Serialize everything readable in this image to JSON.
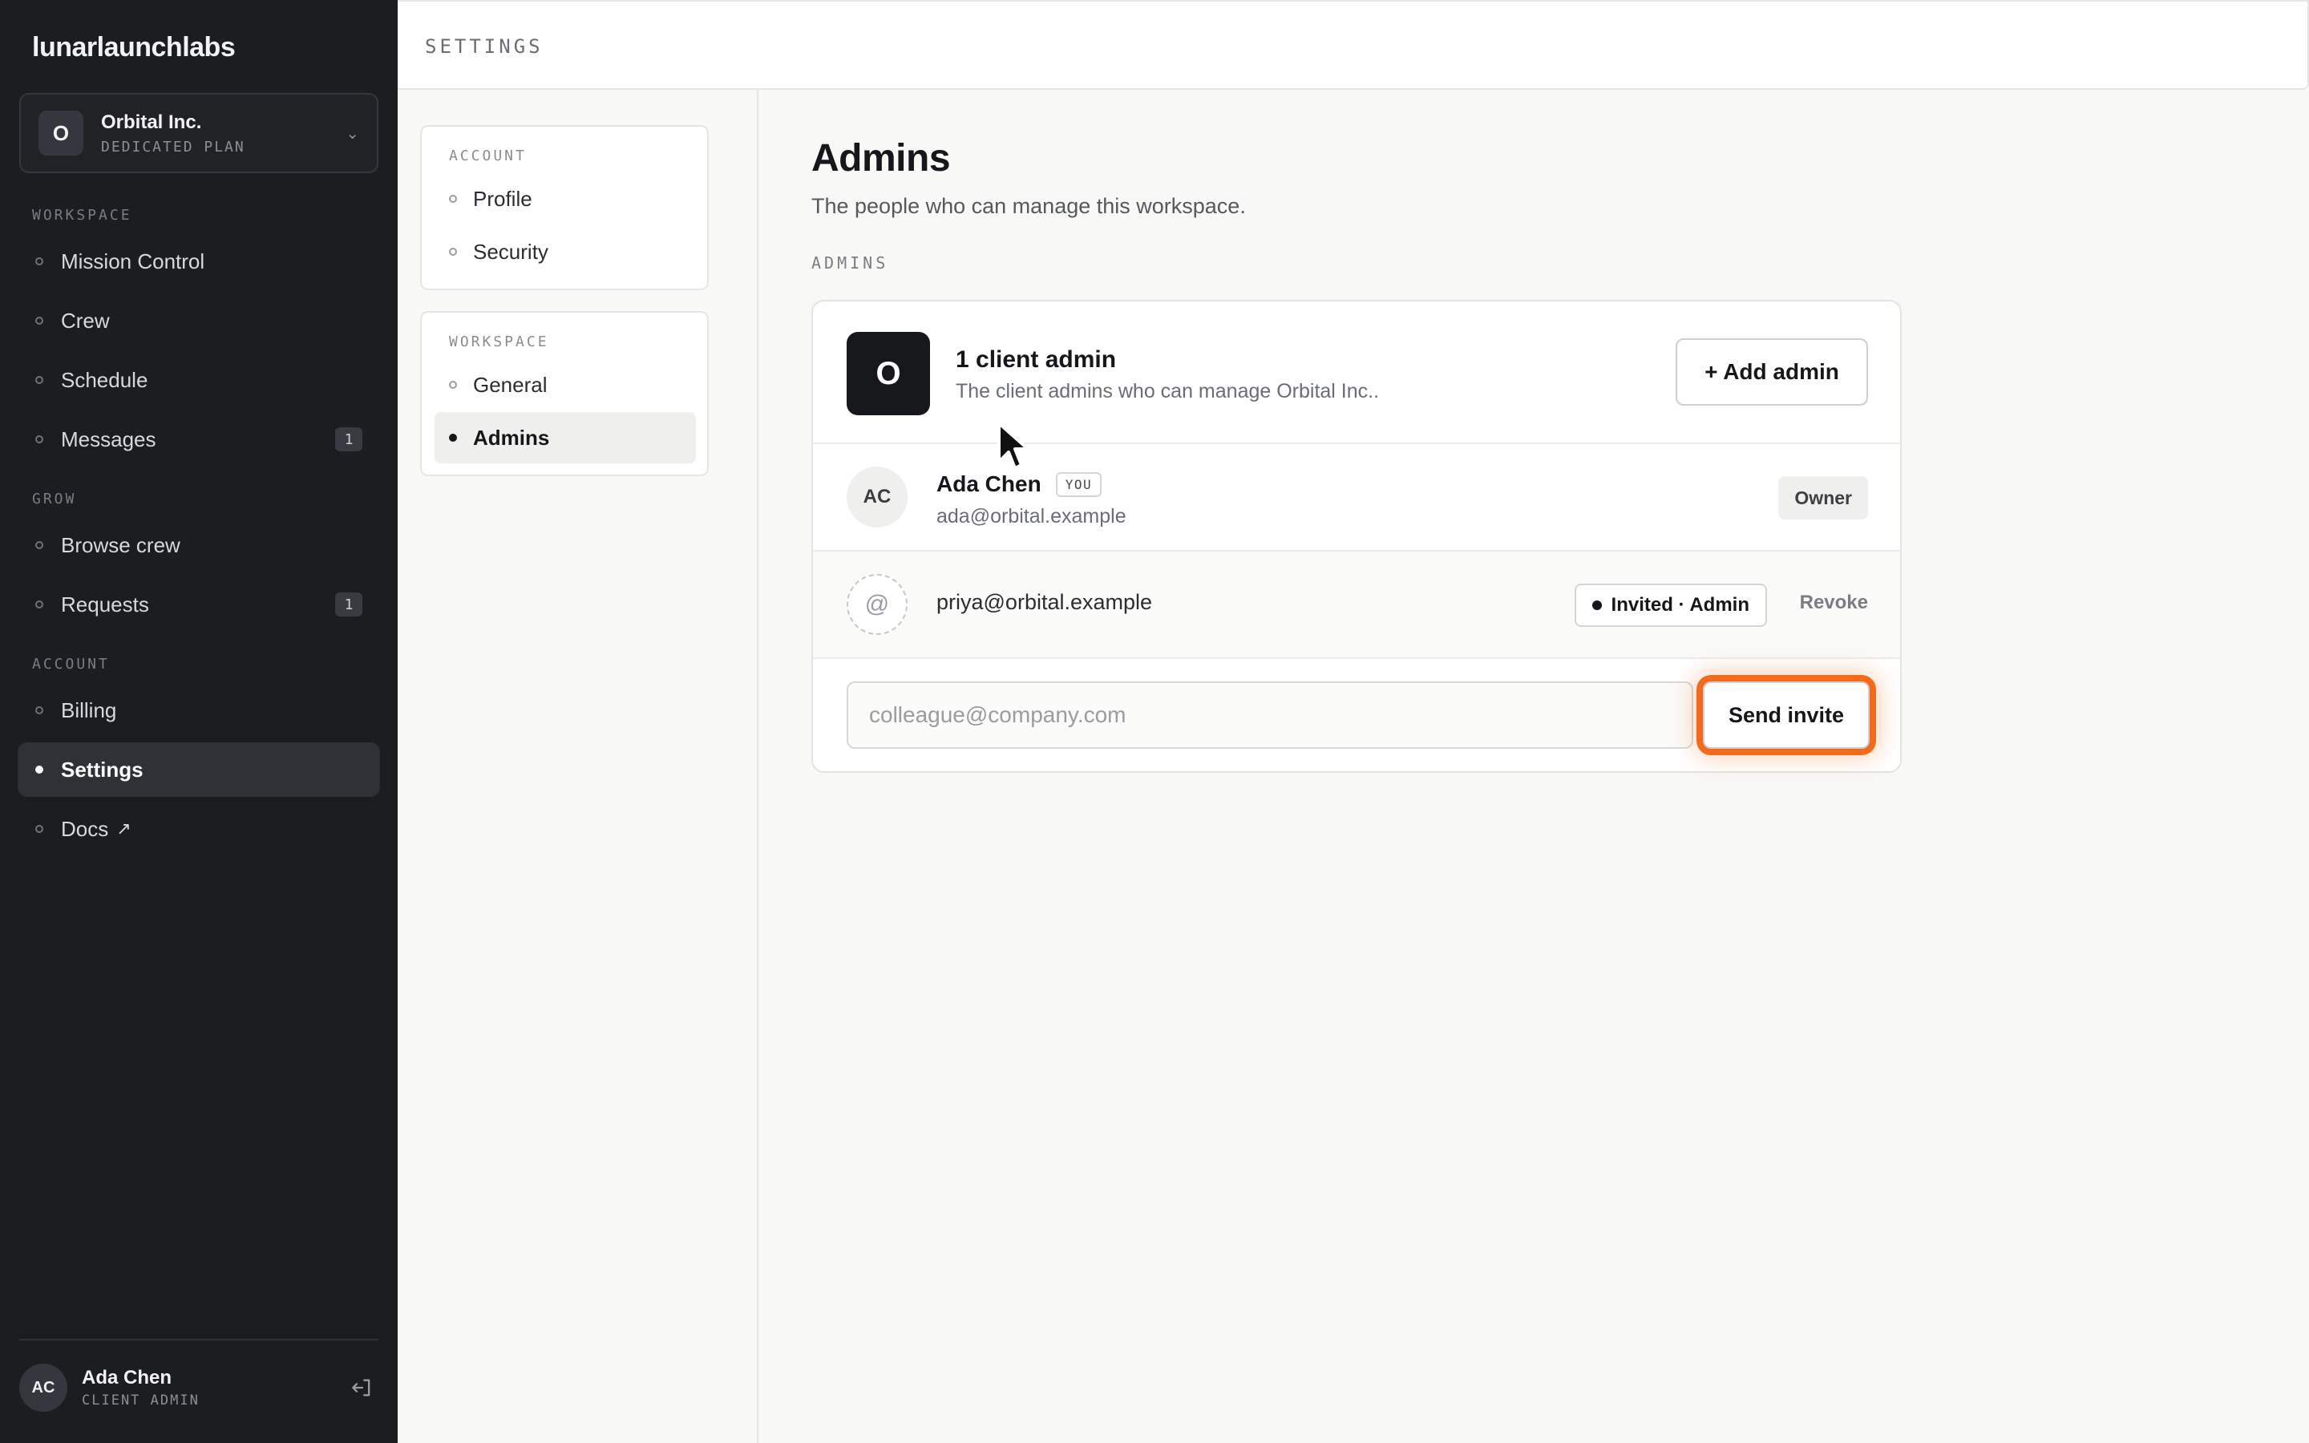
{
  "app": {
    "logo": "lunarlaunchlabs"
  },
  "org": {
    "avatar": "O",
    "name": "Orbital Inc.",
    "plan": "DEDICATED PLAN"
  },
  "sidebar": {
    "sections": [
      {
        "label": "WORKSPACE"
      },
      {
        "label": "GROW"
      },
      {
        "label": "ACCOUNT"
      }
    ],
    "items": [
      {
        "label": "Mission Control"
      },
      {
        "label": "Crew"
      },
      {
        "label": "Schedule"
      },
      {
        "label": "Messages",
        "count": "1"
      },
      {
        "label": "Browse crew"
      },
      {
        "label": "Requests",
        "count": "1"
      },
      {
        "label": "Billing"
      },
      {
        "label": "Settings",
        "active": true
      },
      {
        "label": "Docs",
        "external_icon": "↗"
      }
    ]
  },
  "user": {
    "initials": "AC",
    "name": "Ada Chen",
    "role": "CLIENT ADMIN"
  },
  "topbar": {
    "title": "SETTINGS"
  },
  "subnav": {
    "account_label": "ACCOUNT",
    "account_items": [
      {
        "label": "Profile"
      },
      {
        "label": "Security"
      }
    ],
    "workspace_label": "WORKSPACE",
    "workspace_items": [
      {
        "label": "General"
      },
      {
        "label": "Admins",
        "active": true
      }
    ]
  },
  "main": {
    "title": "Admins",
    "subtitle": "The people who can manage this workspace.",
    "section_label": "ADMINS",
    "card": {
      "avatar": "O",
      "title": "1 client admin",
      "subtitle": "The client admins who can manage Orbital Inc..",
      "add_button": "+ Add admin",
      "members": [
        {
          "initials": "AC",
          "name": "Ada Chen",
          "tag": "YOU",
          "email": "ada@orbital.example",
          "role": "Owner"
        }
      ],
      "invites": [
        {
          "icon_glyph": "@",
          "email": "priya@orbital.example",
          "status": "Invited · Admin",
          "action": "Revoke"
        }
      ],
      "invite_form": {
        "placeholder": "colleague@company.com",
        "value": "",
        "button": "Send invite"
      }
    }
  },
  "colors": {
    "sidebar_bg": "#1b1d21",
    "accent_focus": "#f26b1d",
    "dark": "#16181c"
  }
}
